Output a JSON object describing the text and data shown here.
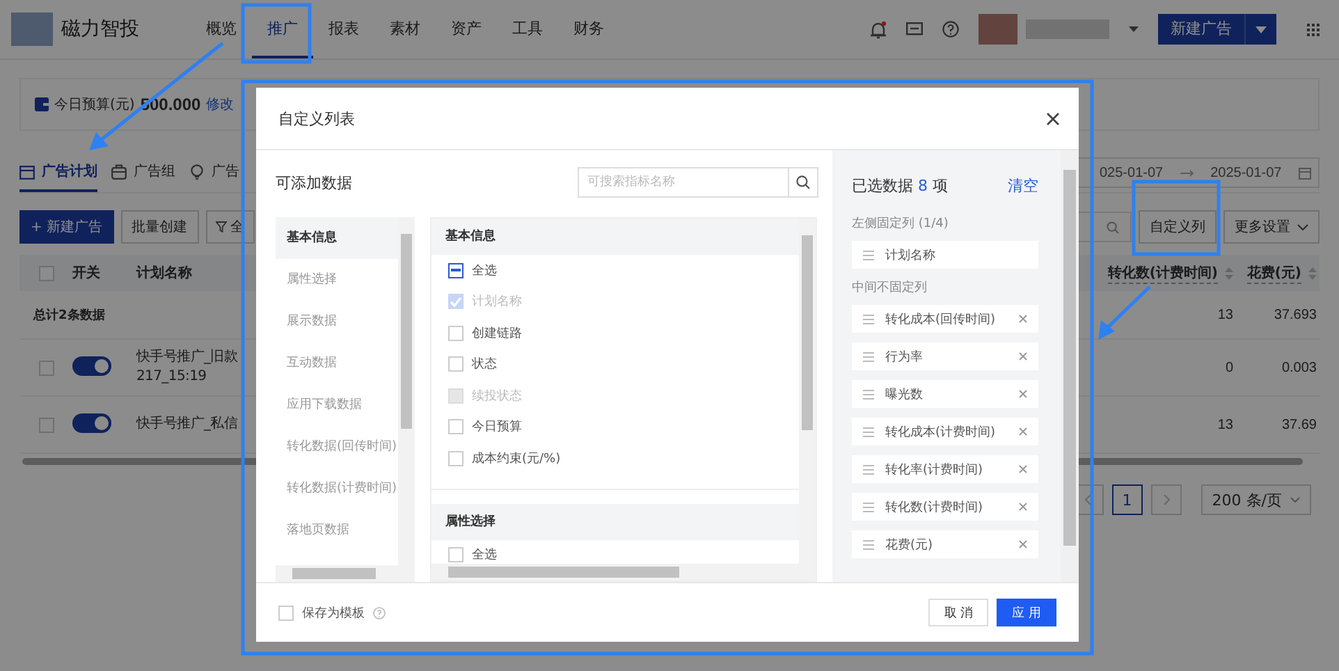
{
  "app": {
    "brand": "磁力智投",
    "nav": [
      {
        "label": "概览",
        "selected": false
      },
      {
        "label": "推广",
        "selected": true
      },
      {
        "label": "报表",
        "selected": false
      },
      {
        "label": "素材",
        "selected": false
      },
      {
        "label": "资产",
        "selected": false
      },
      {
        "label": "工具",
        "selected": false
      },
      {
        "label": "财务",
        "selected": false
      }
    ],
    "new_ad_button": "新建广告",
    "budget": {
      "label": "今日预算(元)",
      "value": "500.000",
      "edit_link": "修改"
    },
    "tabs": [
      {
        "label": "广告计划",
        "selected": true
      },
      {
        "label": "广告组",
        "selected": false
      },
      {
        "label": "广告",
        "selected": false
      }
    ],
    "toolbar_buttons": [
      {
        "label": "+ 新建广告",
        "kind": "primary"
      },
      {
        "label": "批量创建",
        "kind": "default"
      },
      {
        "label": "全",
        "kind": "filter"
      }
    ],
    "date_range": {
      "start": "025-01-07",
      "end": "2025-01-07"
    },
    "custom_columns_button": "自定义列",
    "more_settings": "更多设置",
    "table": {
      "select_all_checked": false,
      "columns": [
        "开关",
        "计划名称",
        "转化数(计费时间)",
        "花费(元)"
      ],
      "summary": {
        "label": "总计2条数据",
        "values": [
          "13",
          "37.693"
        ]
      },
      "rows": [
        {
          "checked": false,
          "on": true,
          "name": "快手号推广_旧款",
          "sub": "217_15:19",
          "values": [
            "0",
            "0.003"
          ]
        },
        {
          "checked": false,
          "on": true,
          "name": "快手号推广_私信",
          "values": [
            "13",
            "37.69"
          ]
        }
      ]
    },
    "pagination": {
      "current_page": "1",
      "page_size": "200 条/页"
    }
  },
  "modal": {
    "title": "自定义列表",
    "available_label": "可添加数据",
    "search_placeholder": "可搜索指标名称",
    "categories": [
      {
        "label": "基本信息",
        "selected": true
      },
      {
        "label": "属性选择",
        "selected": false
      },
      {
        "label": "展示数据",
        "selected": false
      },
      {
        "label": "互动数据",
        "selected": false
      },
      {
        "label": "应用下载数据",
        "selected": false
      },
      {
        "label": "转化数据(回传时间)",
        "selected": false
      },
      {
        "label": "转化数据(计费时间)",
        "selected": false
      },
      {
        "label": "落地页数据",
        "selected": false
      }
    ],
    "groups": [
      {
        "title": "基本信息",
        "options": [
          {
            "label": "全选",
            "checked": false,
            "indeterminate": true,
            "disabled": false
          },
          {
            "label": "计划名称",
            "checked": true,
            "indeterminate": false,
            "disabled": true
          },
          {
            "label": "创建链路",
            "checked": false,
            "indeterminate": false,
            "disabled": false
          },
          {
            "label": "状态",
            "checked": false,
            "indeterminate": false,
            "disabled": false
          },
          {
            "label": "续投状态",
            "checked": false,
            "indeterminate": false,
            "disabled": true
          },
          {
            "label": "今日预算",
            "checked": false,
            "indeterminate": false,
            "disabled": false
          },
          {
            "label": "成本约束(元/%)",
            "checked": false,
            "indeterminate": false,
            "disabled": false
          }
        ]
      },
      {
        "title": "属性选择",
        "options": [
          {
            "label": "全选",
            "checked": false,
            "indeterminate": false,
            "disabled": false
          }
        ]
      }
    ],
    "selected_prefix": "已选数据",
    "selected_count": "8",
    "selected_suffix": "项",
    "clear_link": "清空",
    "fixed_columns": {
      "label": "左侧固定列 (1/4)",
      "items": [
        "计划名称"
      ]
    },
    "scroll_columns": {
      "label": "中间不固定列",
      "items": [
        "转化成本(回传时间)",
        "行为率",
        "曝光数",
        "转化成本(计费时间)",
        "转化率(计费时间)",
        "转化数(计费时间)",
        "花费(元)"
      ]
    },
    "save_template": {
      "label": "保存为模板",
      "checked": false
    },
    "cancel_button": "取 消",
    "apply_button": "应 用"
  }
}
